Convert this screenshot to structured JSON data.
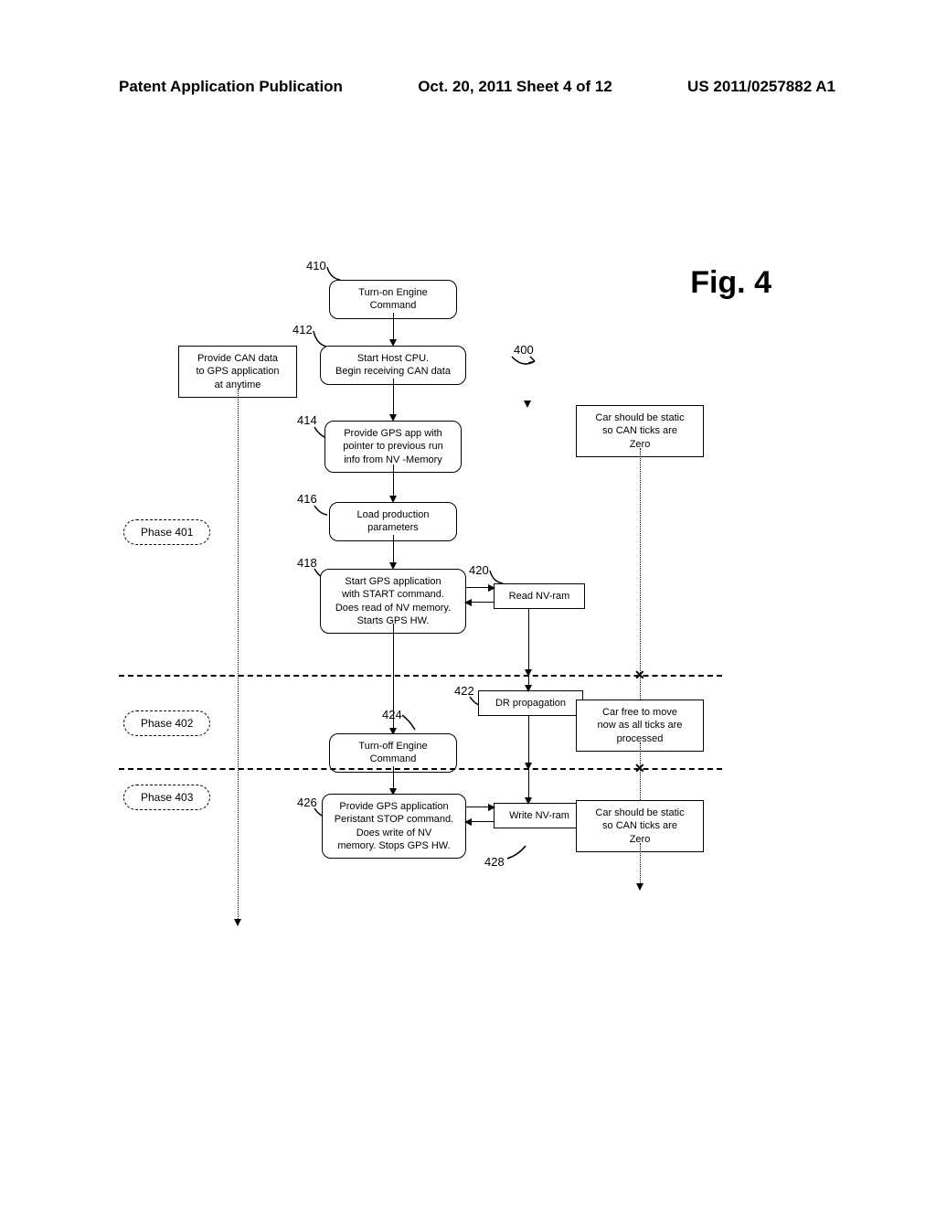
{
  "header": {
    "left": "Patent Application Publication",
    "center": "Oct. 20, 2011  Sheet 4 of 12",
    "right": "US 2011/0257882 A1"
  },
  "figure_title": "Fig. 4",
  "ref_400": "400",
  "labels": {
    "n410": "410",
    "n412": "412",
    "n414": "414",
    "n416": "416",
    "n418": "418",
    "n420": "420",
    "n422": "422",
    "n424": "424",
    "n426": "426",
    "n428": "428"
  },
  "phases": {
    "p401": "Phase 401",
    "p402": "Phase 402",
    "p403": "Phase 403"
  },
  "boxes": {
    "b410": "Turn-on Engine\nCommand",
    "b412": "Start Host CPU.\nBegin receiving CAN data",
    "b_can": "Provide CAN data\nto GPS application\nat anytime",
    "b414": "Provide GPS app with\npointer to previous run\ninfo from NV -Memory",
    "b416": "Load production\nparameters",
    "b418": "Start GPS  application\nwith START command.\nDoes read of NV memory.\nStarts GPS HW.",
    "b420": "Read NV-ram",
    "b422": "DR propagation",
    "b424": "Turn-off Engine\nCommand",
    "b426": "Provide GPS  application\nPeristant STOP command.\nDoes write of NV\nmemory.  Stops GPS HW.",
    "b428": "Write NV-ram",
    "note1": "Car should be static\nso CAN ticks are\nZero",
    "note2": "Car free to move\nnow as all ticks are\nprocessed",
    "note3": "Car should be static\nso CAN ticks are\nZero"
  }
}
